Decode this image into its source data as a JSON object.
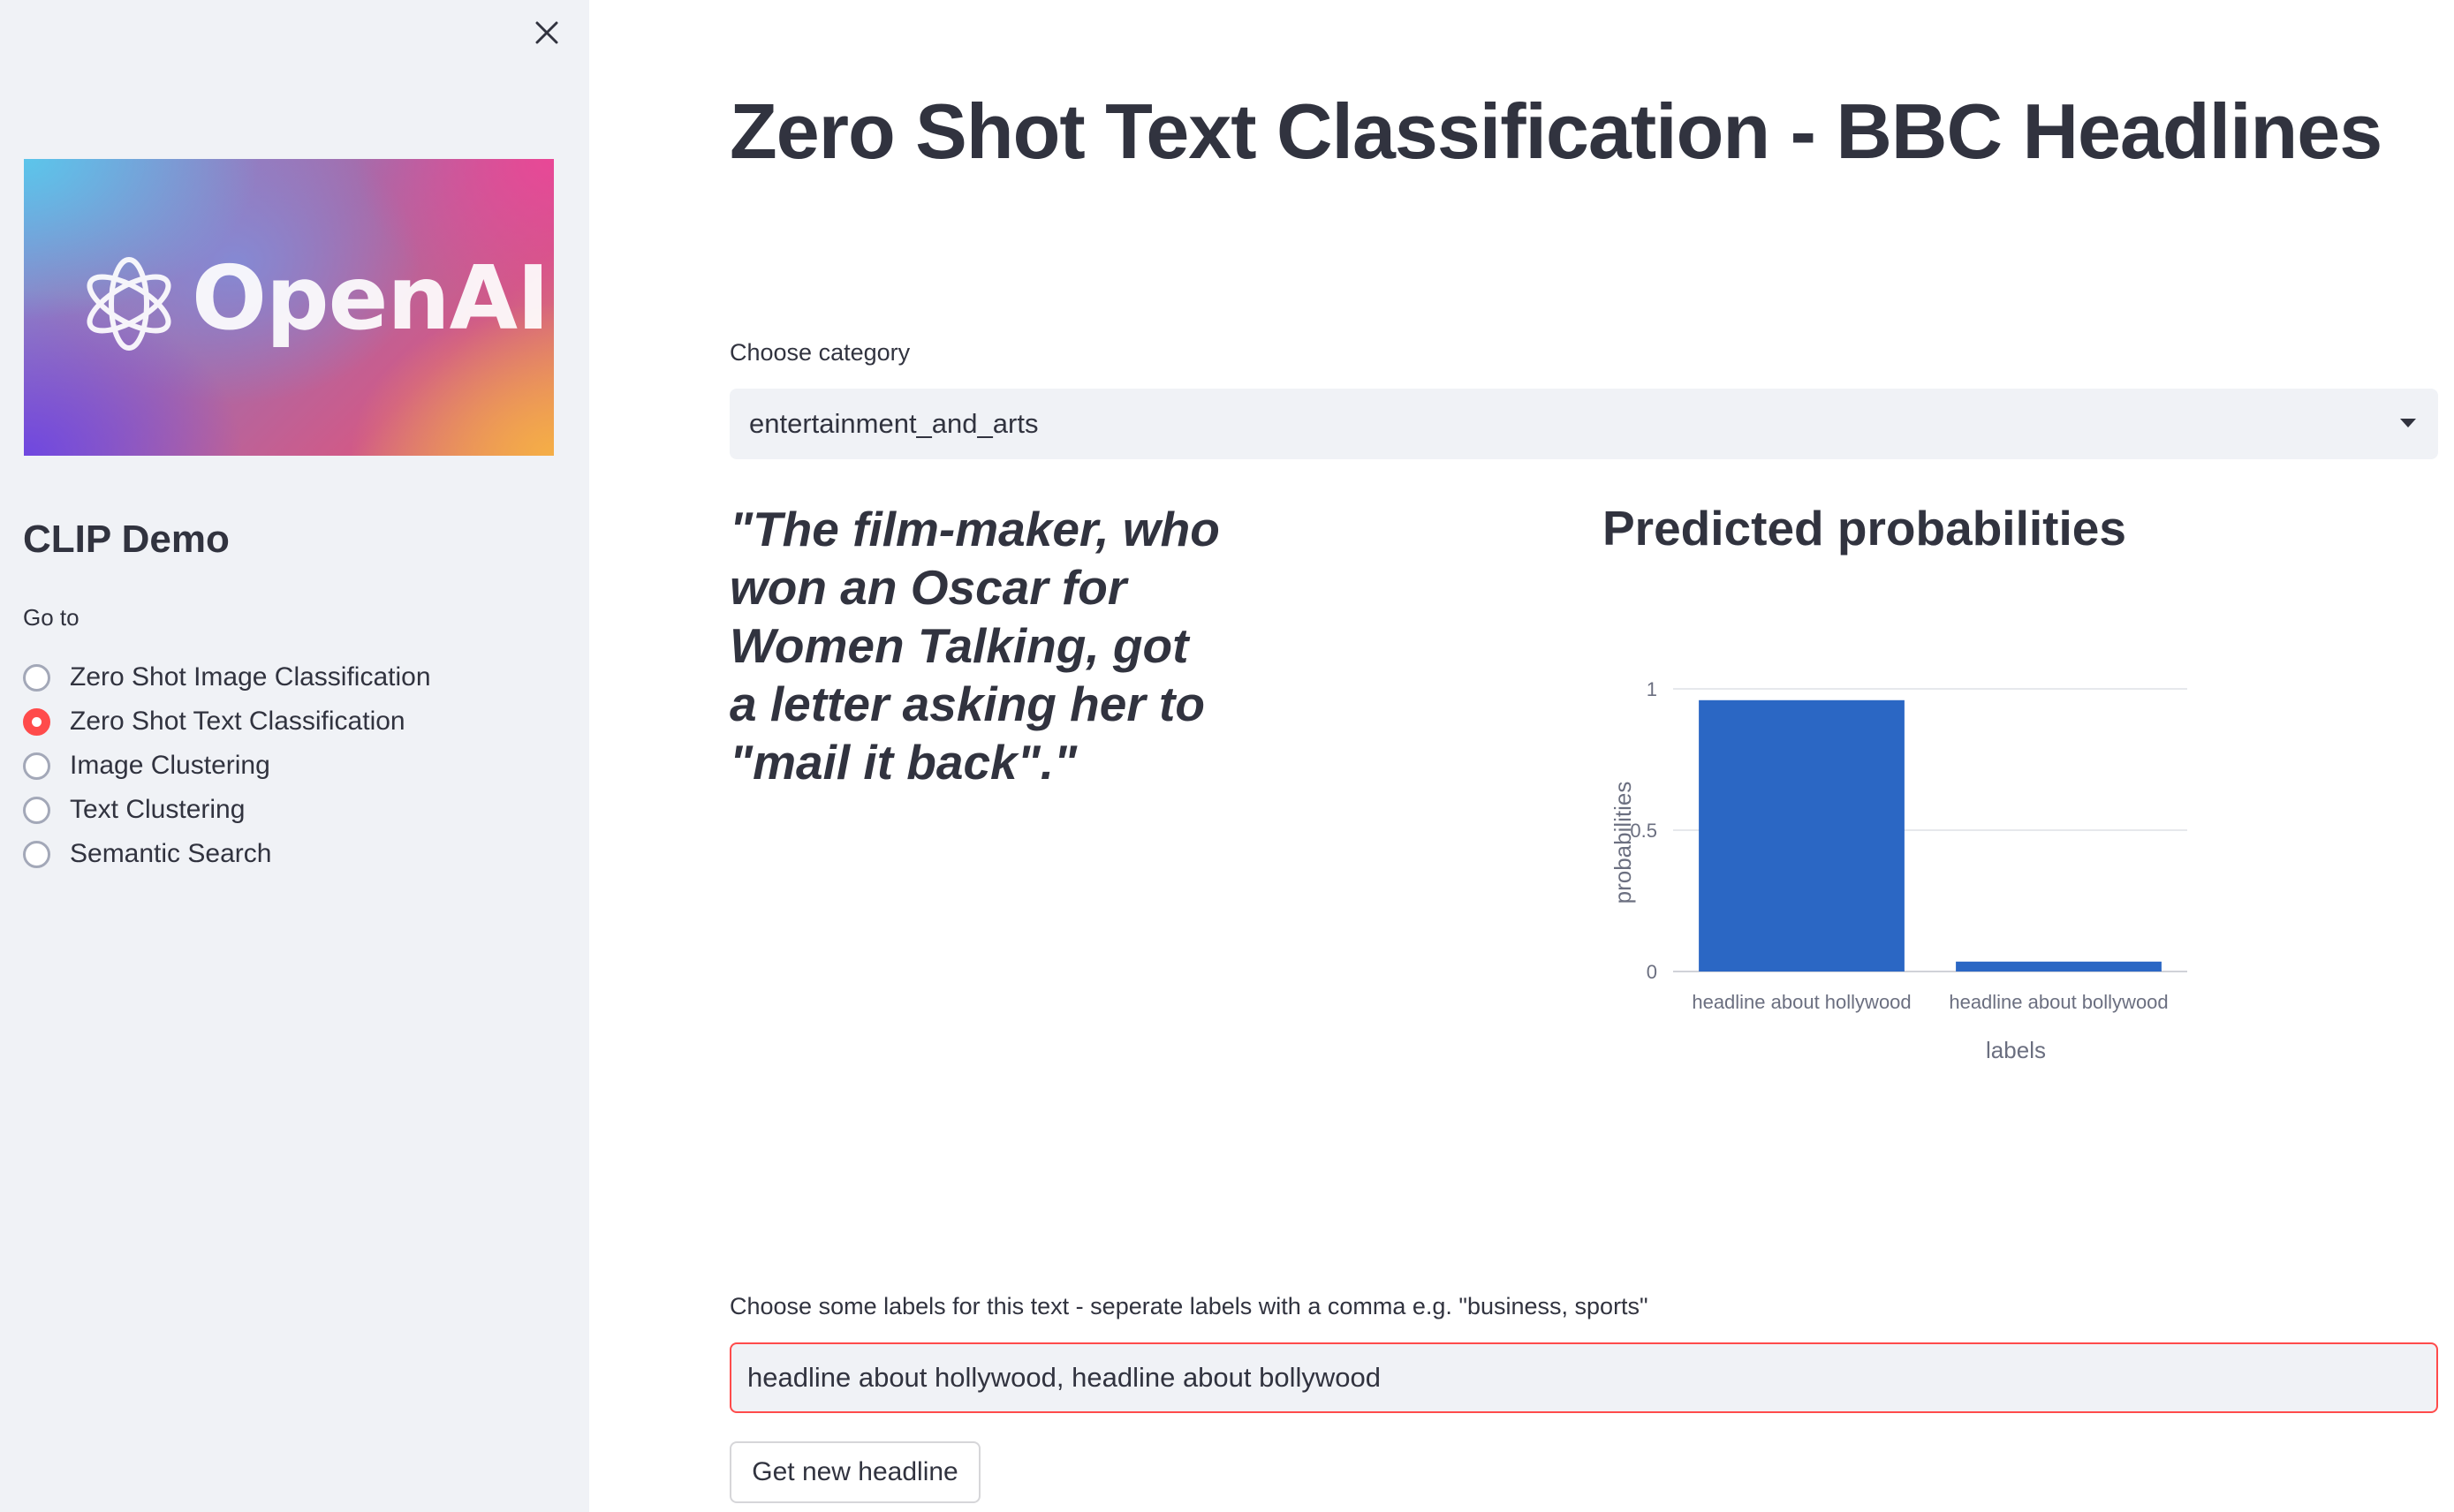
{
  "sidebar": {
    "logo_text": "OpenAI",
    "app_title": "CLIP Demo",
    "goto_label": "Go to",
    "nav_items": [
      {
        "label": "Zero Shot Image Classification",
        "checked": false
      },
      {
        "label": "Zero Shot Text Classification",
        "checked": true
      },
      {
        "label": "Image Clustering",
        "checked": false
      },
      {
        "label": "Text Clustering",
        "checked": false
      },
      {
        "label": "Semantic Search",
        "checked": false
      }
    ]
  },
  "main": {
    "title": "Zero Shot Text Classification - BBC Headlines",
    "category_label": "Choose category",
    "category_value": "entertainment_and_arts",
    "headline": "\"The film-maker, who won an Oscar for Women Talking, got a letter asking her to \"mail it back\".\"",
    "probabilities_title": "Predicted probabilities",
    "labels_help": "Choose some labels for this text - seperate labels with a comma e.g. \"business, sports\"",
    "labels_input_value": "headline about hollywood, headline about bollywood",
    "new_headline_button": "Get new headline"
  },
  "colors": {
    "accent": "#ff4b4b",
    "bar": "#2b67c4",
    "sidebar_bg": "#f0f2f6",
    "text": "#31333f"
  },
  "chart_data": {
    "type": "bar",
    "categories": [
      "headline about hollywood",
      "headline about bollywood"
    ],
    "values": [
      0.96,
      0.035
    ],
    "xlabel": "labels",
    "ylabel": "probabilities",
    "ylim": [
      0,
      1
    ],
    "yticks": [
      0,
      0.5,
      1
    ],
    "ytick_labels": [
      "0",
      "0.5",
      "1"
    ],
    "grid": true,
    "legend": "none"
  }
}
